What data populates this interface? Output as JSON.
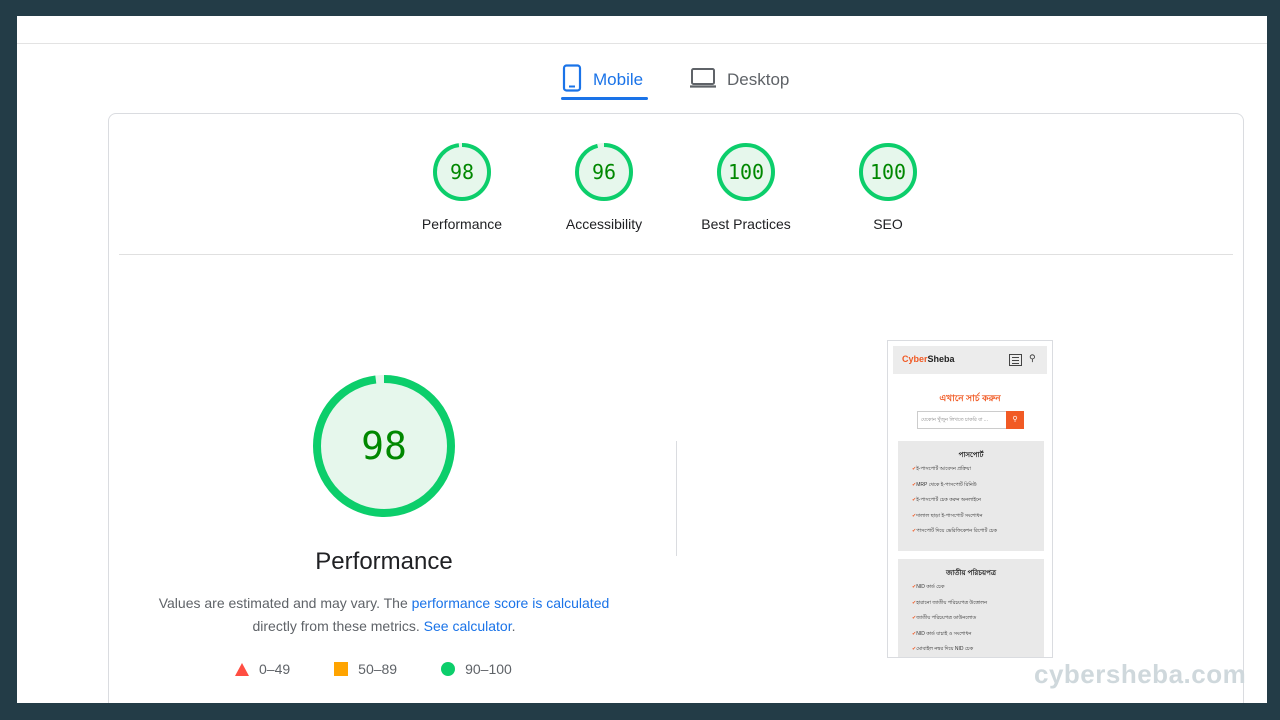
{
  "tabs": [
    {
      "label": "Mobile",
      "icon": "phone-icon",
      "active": true
    },
    {
      "label": "Desktop",
      "icon": "laptop-icon",
      "active": false
    }
  ],
  "scores": [
    {
      "label": "Performance",
      "value": "98"
    },
    {
      "label": "Accessibility",
      "value": "96"
    },
    {
      "label": "Best Practices",
      "value": "100"
    },
    {
      "label": "SEO",
      "value": "100"
    }
  ],
  "performance": {
    "score": "98",
    "score_fraction": 0.98,
    "title": "Performance",
    "desc_prefix": "Values are estimated and may vary. The ",
    "score_link": "performance score is calculated",
    "desc_middle": " directly from these metrics. ",
    "calculator_link": "See calculator",
    "desc_suffix": "."
  },
  "legend": [
    {
      "range": "0–49",
      "shape": "triangle",
      "color": "#f33"
    },
    {
      "range": "50–89",
      "shape": "square",
      "color": "#ffaa33"
    },
    {
      "range": "90–100",
      "shape": "circle",
      "color": "#0cce6b"
    }
  ],
  "colors": {
    "good": "#0cce6b",
    "good_bg": "#e6f7ec",
    "good_text": "#008800",
    "accent": "#1a73e8"
  },
  "thumbnail": {
    "logo_part1": "Cyber",
    "logo_part2": "Sheba",
    "heading": "এখানে সার্চ করুন",
    "search_placeholder": "যেকোন খুঁজুন লিখতে চাকরি বা ...",
    "box1_title": "পাসপোর্ট",
    "box1_items": [
      "ই-পাসপোর্ট আবেদন প্রক্রিয়া",
      "MRP থেকে ই-পাসপোর্ট রিনিউ",
      "ই-পাসপোর্ট চেক করুন অনলাইনে",
      "দালাল ছাড়া ই-পাসপোর্ট সংশোধন",
      "পাসপোর্ট দিয়ে ভেরিফিকেশন রিপোর্ট চেক"
    ],
    "box2_title": "জাতীয় পরিচয়পত্র",
    "box2_items": [
      "NID কার্ড চেক",
      "হারানো জাতীয় পরিচয়পত্র উত্তোলন",
      "জাতীয় পরিচয়পত্র ডাউনলোড",
      "NID কার্ড যাচাই ও সংশোধন",
      "মোবাইল নম্বর দিয়ে NID চেক"
    ]
  },
  "watermark": "cybersheba.com"
}
